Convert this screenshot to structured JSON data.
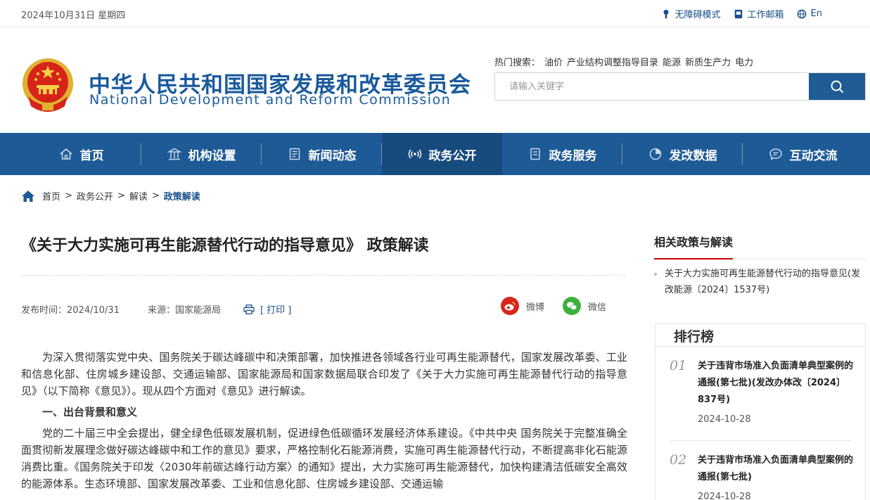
{
  "topbar": {
    "date": "2024年10月31日 星期四",
    "accessibility": "无障碍模式",
    "mail": "工作邮箱",
    "lang": "En"
  },
  "header": {
    "title_cn": "中华人民共和国国家发展和改革委员会",
    "title_en": "National Development and Reform Commission",
    "hot_label": "热门搜索：",
    "hot_items": [
      "油价",
      "产业结构调整指导目录",
      "能源",
      "新质生产力",
      "电力"
    ],
    "search_placeholder": "请输入关键字"
  },
  "nav": [
    {
      "label": "首页",
      "icon": "home-icon"
    },
    {
      "label": "机构设置",
      "icon": "building-icon"
    },
    {
      "label": "新闻动态",
      "icon": "news-icon"
    },
    {
      "label": "政务公开",
      "icon": "broadcast-icon"
    },
    {
      "label": "政务服务",
      "icon": "service-icon"
    },
    {
      "label": "发改数据",
      "icon": "pie-chart-icon"
    },
    {
      "label": "互动交流",
      "icon": "chat-icon"
    }
  ],
  "breadcrumb": [
    "首页",
    ">",
    "政务公开",
    ">",
    "解读",
    ">",
    "政策解读"
  ],
  "article": {
    "title": "《关于大力实施可再生能源替代行动的指导意见》 政策解读",
    "publish_time": "发布时间：2024/10/31",
    "source": "来源：国家能源局",
    "print": "[ 打印 ]",
    "share_weibo": "微博",
    "share_wechat": "微信",
    "para1": "为深入贯彻落实党中央、国务院关于碳达峰碳中和决策部署，加快推进各领域各行业可再生能源替代，国家发展改革委、工业和信息化部、住房城乡建设部、交通运输部、国家能源局和国家数据局联合印发了《关于大力实施可再生能源替代行动的指导意见》（以下简称《意见》）。现从四个方面对《意见》进行解读。",
    "section1": "一、出台背景和意义",
    "para2": "党的二十届三中全会提出，健全绿色低碳发展机制，促进绿色低碳循环发展经济体系建设。《中共中央 国务院关于完整准确全面贯彻新发展理念做好碳达峰碳中和工作的意见》要求，严格控制化石能源消费，实施可再生能源替代行动，不断提高非化石能源消费比重。《国务院关于印发〈2030年前碳达峰行动方案〉的通知》提出，大力实施可再生能源替代，加快构建清洁低碳安全高效的能源体系。生态环境部、国家发展改革委、工业和信息化部、住房城乡建设部、交通运输"
  },
  "sidebar": {
    "related_title": "相关政策与解读",
    "related_item": "关于大力实施可再生能源替代行动的指导意见(发改能源〔2024〕1537号)",
    "rank_title": "排行榜",
    "rank_items": [
      {
        "num": "01",
        "title": "关于违背市场准入负面清单典型案例的通报(第七批)(发改办体改〔2024〕837号)",
        "date": "2024-10-28"
      },
      {
        "num": "02",
        "title": "关于违背市场准入负面清单典型案例的通报(第七批)",
        "date": "2024-10-28"
      }
    ]
  },
  "colors": {
    "brand_blue": "#1e5b96",
    "nav_active": "#174a7d",
    "accent_red": "#c40000",
    "weibo_red": "#d9261c",
    "wechat_green": "#3bb13b"
  }
}
